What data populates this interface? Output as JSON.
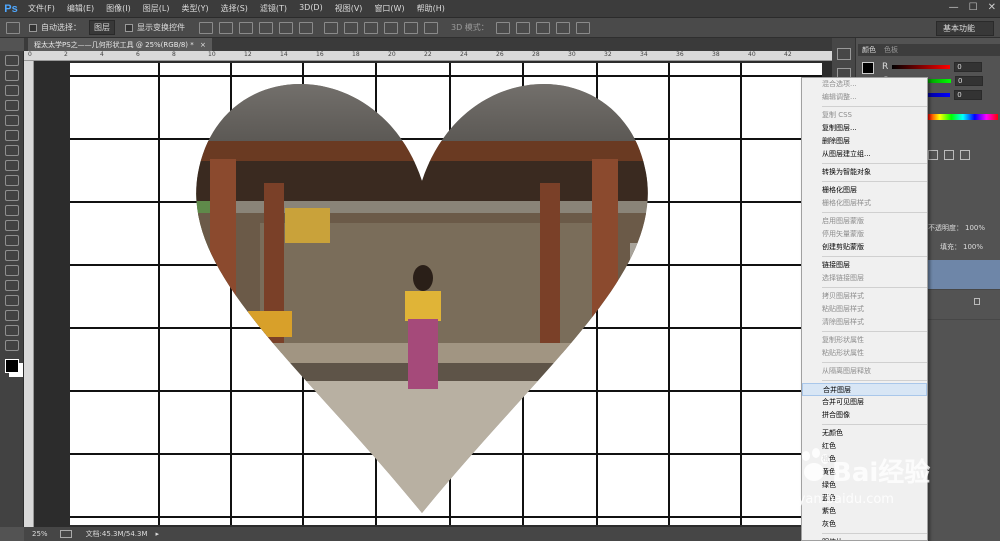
{
  "app": {
    "logo": "Ps"
  },
  "menu": [
    "文件(F)",
    "编辑(E)",
    "图像(I)",
    "图层(L)",
    "类型(Y)",
    "选择(S)",
    "滤镜(T)",
    "3D(D)",
    "视图(V)",
    "窗口(W)",
    "帮助(H)"
  ],
  "window_controls": [
    "—",
    "☐",
    "✕"
  ],
  "options": {
    "auto_select_label": "自动选择：",
    "auto_select_value": "图层",
    "show_transform_label": "显示变换控件",
    "mode_3d_label": "3D 模式：",
    "workspace": "基本功能"
  },
  "tab": {
    "title": "程太太学PS之——几何形状工具 @ 25%(RGB/8) *",
    "close": "×"
  },
  "ruler": [
    "0",
    "2",
    "4",
    "6",
    "8",
    "10",
    "12",
    "14",
    "16",
    "18",
    "20",
    "22",
    "24",
    "26",
    "28",
    "30",
    "32",
    "34",
    "36",
    "38",
    "40",
    "42"
  ],
  "status": {
    "zoom": "25%",
    "doc": "文档:45.3M/54.3M"
  },
  "color_panel": {
    "tabs": [
      "颜色",
      "色板"
    ],
    "channels": [
      {
        "name": "R",
        "value": "0"
      },
      {
        "name": "G",
        "value": "0"
      },
      {
        "name": "B",
        "value": "0"
      }
    ]
  },
  "layers_panel": {
    "opacity_label": "不透明度：",
    "opacity_value": "100%",
    "fill_label": "填充：",
    "fill_value": "100%"
  },
  "context_menu": {
    "items": [
      {
        "label": "混合选项...",
        "enabled": false
      },
      {
        "label": "编辑调整...",
        "enabled": false
      },
      {
        "sep": true
      },
      {
        "label": "复制 CSS",
        "enabled": false
      },
      {
        "label": "复制图层...",
        "enabled": true
      },
      {
        "label": "删除图层",
        "enabled": true
      },
      {
        "label": "从图层建立组...",
        "enabled": true
      },
      {
        "sep": true
      },
      {
        "label": "转换为智能对象",
        "enabled": true
      },
      {
        "sep": true
      },
      {
        "label": "栅格化图层",
        "enabled": true
      },
      {
        "label": "栅格化图层样式",
        "enabled": false
      },
      {
        "sep": true
      },
      {
        "label": "启用图层蒙版",
        "enabled": false
      },
      {
        "label": "停用矢量蒙版",
        "enabled": false
      },
      {
        "label": "创建剪贴蒙版",
        "enabled": true
      },
      {
        "sep": true
      },
      {
        "label": "链接图层",
        "enabled": true
      },
      {
        "label": "选择链接图层",
        "enabled": false
      },
      {
        "sep": true
      },
      {
        "label": "拷贝图层样式",
        "enabled": false
      },
      {
        "label": "粘贴图层样式",
        "enabled": false
      },
      {
        "label": "清除图层样式",
        "enabled": false
      },
      {
        "sep": true
      },
      {
        "label": "复制形状属性",
        "enabled": false
      },
      {
        "label": "粘贴形状属性",
        "enabled": false
      },
      {
        "sep": true
      },
      {
        "label": "从隔离图层释放",
        "enabled": false
      },
      {
        "sep": true
      },
      {
        "label": "合并图层",
        "enabled": true,
        "highlight": true
      },
      {
        "label": "合并可见图层",
        "enabled": true
      },
      {
        "label": "拼合图像",
        "enabled": true
      },
      {
        "sep": true
      },
      {
        "label": "无颜色",
        "enabled": true
      },
      {
        "label": "红色",
        "enabled": true
      },
      {
        "label": "橙色",
        "enabled": true
      },
      {
        "label": "黄色",
        "enabled": true
      },
      {
        "label": "绿色",
        "enabled": true
      },
      {
        "label": "蓝色",
        "enabled": true
      },
      {
        "label": "紫色",
        "enabled": true
      },
      {
        "label": "灰色",
        "enabled": true
      },
      {
        "sep": true
      },
      {
        "label": "明信片",
        "enabled": true
      }
    ]
  },
  "watermark": {
    "main": "Bai经验",
    "sub": "jingyan.baidu.com"
  },
  "colors": {
    "accent": "#4fa8ff",
    "menu_highlight": "#d8e6f5",
    "grid_line": "#111111"
  }
}
